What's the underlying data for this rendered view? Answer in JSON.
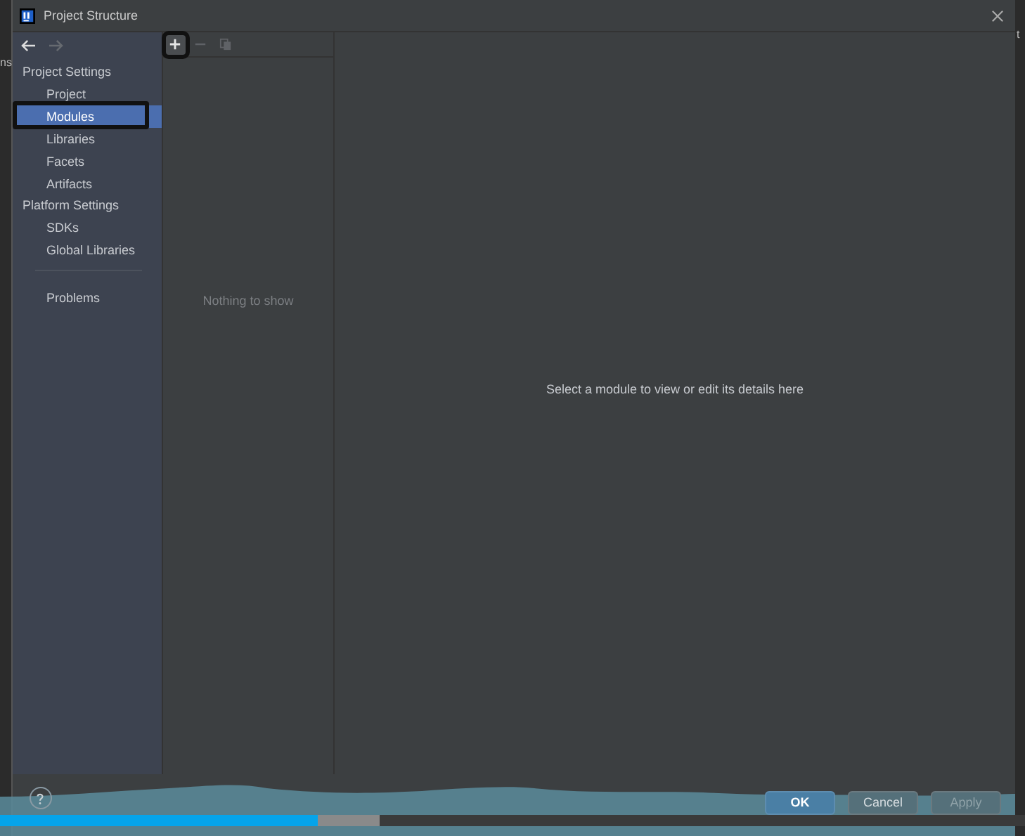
{
  "background_text": {
    "left_edge": "ns",
    "right_edge": "t"
  },
  "window": {
    "title": "Project Structure"
  },
  "sidebar": {
    "sections": [
      {
        "heading": "Project Settings",
        "items": [
          {
            "label": "Project",
            "selected": false,
            "highlighted": false
          },
          {
            "label": "Modules",
            "selected": true,
            "highlighted": true
          },
          {
            "label": "Libraries",
            "selected": false,
            "highlighted": false
          },
          {
            "label": "Facets",
            "selected": false,
            "highlighted": false
          },
          {
            "label": "Artifacts",
            "selected": false,
            "highlighted": false
          }
        ]
      },
      {
        "heading": "Platform Settings",
        "items": [
          {
            "label": "SDKs",
            "selected": false,
            "highlighted": false
          },
          {
            "label": "Global Libraries",
            "selected": false,
            "highlighted": false
          }
        ]
      }
    ],
    "problems": {
      "label": "Problems",
      "selected": false,
      "highlighted": false
    }
  },
  "module_list": {
    "toolbar": [
      {
        "kind": "add",
        "disabled": false,
        "highlighted": true
      },
      {
        "kind": "remove",
        "disabled": true,
        "highlighted": false
      },
      {
        "kind": "copy",
        "disabled": true,
        "highlighted": false
      }
    ],
    "empty_text": "Nothing to show"
  },
  "details": {
    "empty_text": "Select a module to view or edit its details here"
  },
  "buttons": [
    {
      "label": "OK",
      "kind": "default"
    },
    {
      "label": "Cancel",
      "kind": "normal"
    },
    {
      "label": "Apply",
      "kind": "disabled"
    }
  ],
  "video": {
    "progress": {
      "level": 0.31
    }
  }
}
